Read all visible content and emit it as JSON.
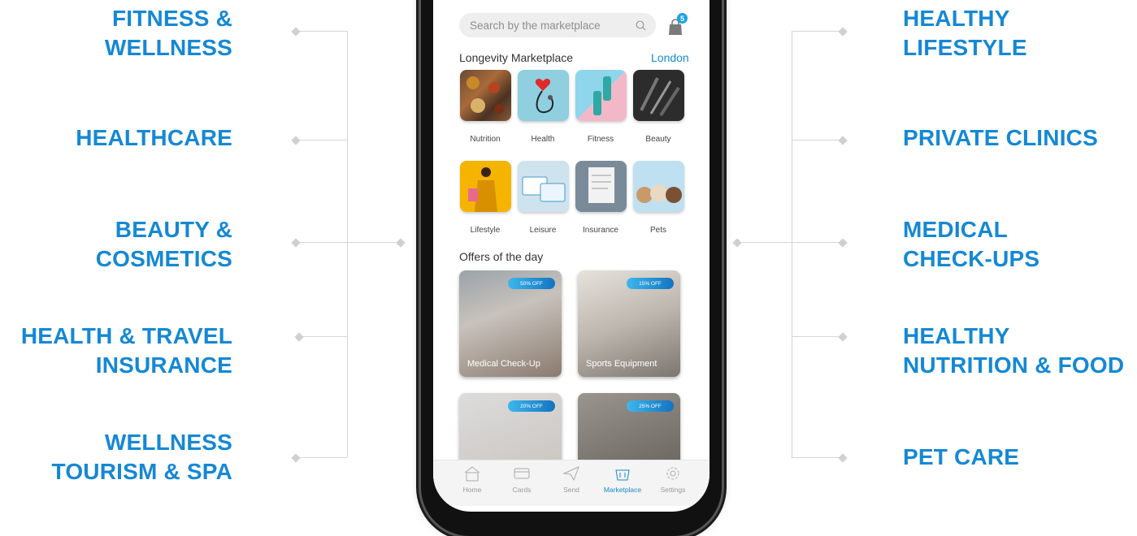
{
  "left_labels": [
    [
      "FITNESS &",
      "WELLNESS"
    ],
    [
      "HEALTHCARE"
    ],
    [
      "BEAUTY &",
      "COSMETICS"
    ],
    [
      "HEALTH & TRAVEL",
      "INSURANCE"
    ],
    [
      "WELLNESS",
      "TOURISM & SPA"
    ]
  ],
  "right_labels": [
    [
      "HEALTHY",
      "LIFESTYLE"
    ],
    [
      "PRIVATE CLINICS"
    ],
    [
      "MEDICAL",
      "CHECK-UPS"
    ],
    [
      "HEALTHY",
      "NUTRITION & FOOD"
    ],
    [
      "PET CARE"
    ]
  ],
  "app": {
    "search_placeholder": "Search by the marketplace",
    "cart_count": "5",
    "marketplace_title": "Longevity Marketplace",
    "city": "London",
    "categories": [
      {
        "label": "Nutrition",
        "icon": "nutrition-image"
      },
      {
        "label": "Health",
        "icon": "health-image"
      },
      {
        "label": "Fitness",
        "icon": "fitness-image"
      },
      {
        "label": "Beauty",
        "icon": "beauty-image"
      },
      {
        "label": "Lifestyle",
        "icon": "lifestyle-image"
      },
      {
        "label": "Leisure",
        "icon": "leisure-image"
      },
      {
        "label": "Insurance",
        "icon": "insurance-image"
      },
      {
        "label": "Pets",
        "icon": "pets-image"
      }
    ],
    "offers_title": "Offers of the day",
    "offers": [
      {
        "title": "Medical Check-Up",
        "discount": "50% OFF"
      },
      {
        "title": "Sports Equipment",
        "discount": "15% OFF"
      },
      {
        "title": "",
        "discount": "20% OFF"
      },
      {
        "title": "",
        "discount": "25% OFF"
      }
    ],
    "tabs": [
      {
        "label": "Home",
        "icon": "home-icon",
        "active": false
      },
      {
        "label": "Cards",
        "icon": "cards-icon",
        "active": false
      },
      {
        "label": "Send",
        "icon": "send-icon",
        "active": false
      },
      {
        "label": "Marketplace",
        "icon": "basket-icon",
        "active": true
      },
      {
        "label": "Settings",
        "icon": "gear-icon",
        "active": false
      }
    ]
  },
  "colors": {
    "accent": "#1588d4",
    "line": "#d6d6d6",
    "pill_start": "#3fb6ec",
    "pill_end": "#1274c0"
  }
}
